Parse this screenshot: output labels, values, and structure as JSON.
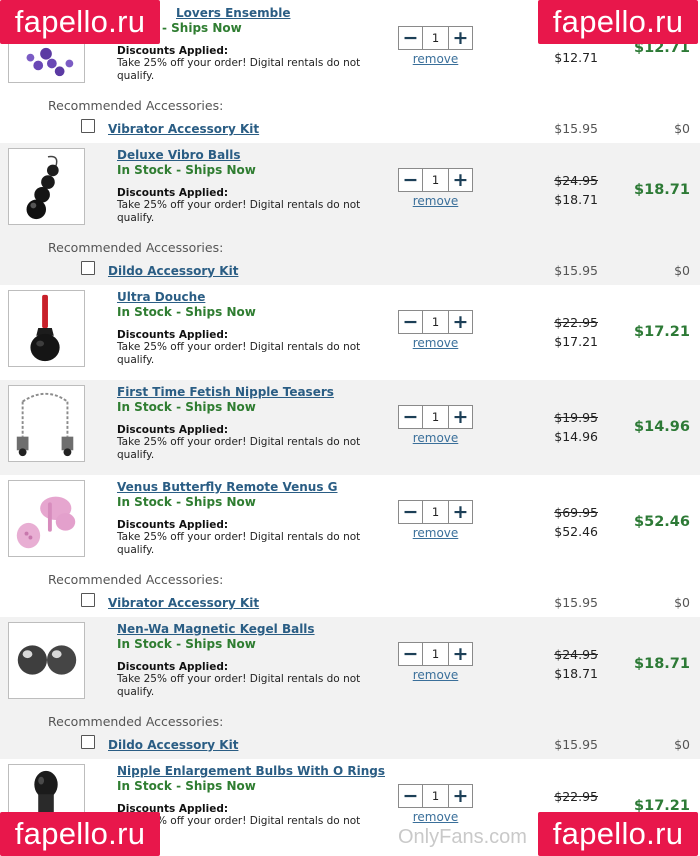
{
  "cart": {
    "items": [
      {
        "name": "Lovers Ensemble",
        "stock": "- Ships Now",
        "discount_title": "Discounts Applied:",
        "discount_text": "Take 25% off your order! Digital rentals do not qualify.",
        "quantity": "1",
        "remove_label": "remove",
        "original_price": "",
        "sale_price": "$12.71",
        "total": "$12.71",
        "thumb_icon": "purple-beads-icon"
      },
      {
        "name": "Deluxe Vibro Balls",
        "stock": "In Stock - Ships Now",
        "discount_title": "Discounts Applied:",
        "discount_text": "Take 25% off your order! Digital rentals do not qualify.",
        "quantity": "1",
        "remove_label": "remove",
        "original_price": "$24.95",
        "sale_price": "$18.71",
        "total": "$18.71",
        "thumb_icon": "black-balls-icon"
      },
      {
        "name": "Ultra Douche",
        "stock": "In Stock - Ships Now",
        "discount_title": "Discounts Applied:",
        "discount_text": "Take 25% off your order! Digital rentals do not qualify.",
        "quantity": "1",
        "remove_label": "remove",
        "original_price": "$22.95",
        "sale_price": "$17.21",
        "total": "$17.21",
        "thumb_icon": "bulb-icon"
      },
      {
        "name": "First Time Fetish Nipple Teasers",
        "stock": "In Stock - Ships Now",
        "discount_title": "Discounts Applied:",
        "discount_text": "Take 25% off your order! Digital rentals do not qualify.",
        "quantity": "1",
        "remove_label": "remove",
        "original_price": "$19.95",
        "sale_price": "$14.96",
        "total": "$14.96",
        "thumb_icon": "chain-clamps-icon"
      },
      {
        "name": "Venus Butterfly Remote Venus G",
        "stock": "In Stock - Ships Now",
        "discount_title": "Discounts Applied:",
        "discount_text": "Take 25% off your order! Digital rentals do not qualify.",
        "quantity": "1",
        "remove_label": "remove",
        "original_price": "$69.95",
        "sale_price": "$52.46",
        "total": "$52.46",
        "thumb_icon": "pink-butterfly-icon"
      },
      {
        "name": "Nen-Wa Magnetic Kegel Balls",
        "stock": "In Stock - Ships Now",
        "discount_title": "Discounts Applied:",
        "discount_text": "Take 25% off your order! Digital rentals do not qualify.",
        "quantity": "1",
        "remove_label": "remove",
        "original_price": "$24.95",
        "sale_price": "$18.71",
        "total": "$18.71",
        "thumb_icon": "silver-balls-icon"
      },
      {
        "name": "Nipple Enlargement Bulbs With O Rings",
        "stock": "In Stock - Ships Now",
        "discount_title": "Discounts Applied:",
        "discount_text": "Take 25% off your order! Digital rentals do not qualify.",
        "quantity": "1",
        "remove_label": "remove",
        "original_price": "$22.95",
        "sale_price": "",
        "total": "$17.21",
        "thumb_icon": "black-bulb-icon"
      }
    ],
    "recommended_label": "Recommended Accessories:",
    "accessories": [
      {
        "name": "Vibrator Accessory Kit",
        "price": "$15.95",
        "add_price": "$0"
      },
      {
        "name": "Dildo Accessory Kit",
        "price": "$15.95",
        "add_price": "$0"
      },
      {
        "name": "Vibrator Accessory Kit",
        "price": "$15.95",
        "add_price": "$0"
      },
      {
        "name": "Dildo Accessory Kit",
        "price": "$15.95",
        "add_price": "$0"
      }
    ],
    "controls": {
      "minus": "−",
      "plus": "+"
    }
  },
  "watermarks": {
    "brand": "fapello.ru",
    "onlyfans": "OnlyFans.com"
  },
  "colors": {
    "link": "#2a5d84",
    "stock_green": "#2f7d31",
    "total_green": "#2d7a36",
    "watermark_red": "#e8174b",
    "band_gray": "#f2f2f2"
  }
}
